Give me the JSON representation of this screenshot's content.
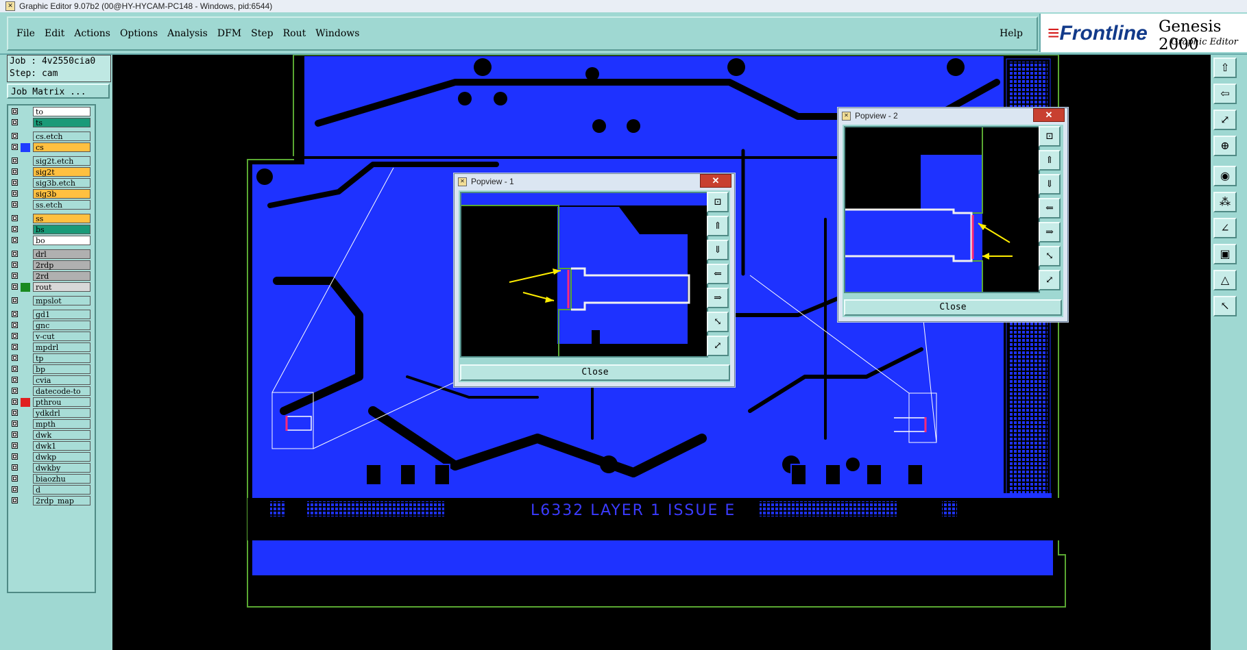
{
  "window": {
    "title": "Graphic Editor 9.07b2 (00@HY-HYCAM-PC148 - Windows, pid:6544)"
  },
  "menu": {
    "items": [
      "File",
      "Edit",
      "Actions",
      "Options",
      "Analysis",
      "DFM",
      "Step",
      "Rout",
      "Windows"
    ],
    "help": "Help"
  },
  "brand": {
    "logo_f": "F",
    "logo_rest": "Frontline",
    "product": "Genesis 2000",
    "subtitle": "Graphic Editor"
  },
  "job": {
    "job_line": "Job : 4v2550cia0",
    "step_line": "Step: cam",
    "matrix_label": "Job Matrix ..."
  },
  "layers": [
    {
      "name": "to",
      "color": "#ffffff",
      "swatch": ""
    },
    {
      "name": "ts",
      "color": "#1a9a78",
      "swatch": ""
    },
    {
      "name": "cs.etch",
      "color": "#a8ddd7",
      "swatch": ""
    },
    {
      "name": "cs",
      "color": "#ffc040",
      "swatch": "#1f3cff"
    },
    {
      "name": "sig2t.etch",
      "color": "#a8ddd7",
      "swatch": ""
    },
    {
      "name": "sig2t",
      "color": "#ffc040",
      "swatch": ""
    },
    {
      "name": "sig3b.etch",
      "color": "#a8ddd7",
      "swatch": ""
    },
    {
      "name": "sig3b",
      "color": "#ffc040",
      "swatch": ""
    },
    {
      "name": "ss.etch",
      "color": "#a8ddd7",
      "swatch": ""
    },
    {
      "name": "ss",
      "color": "#ffc040",
      "swatch": ""
    },
    {
      "name": "bs",
      "color": "#1a9a78",
      "swatch": ""
    },
    {
      "name": "bo",
      "color": "#ffffff",
      "swatch": ""
    },
    {
      "name": "drl",
      "color": "#b0b0b0",
      "swatch": ""
    },
    {
      "name": "2rdp",
      "color": "#b0b0b0",
      "swatch": ""
    },
    {
      "name": "2rd",
      "color": "#b0b0b0",
      "swatch": ""
    },
    {
      "name": "rout",
      "color": "#d8d8d8",
      "swatch": "#1a8a20"
    },
    {
      "name": "mpslot",
      "color": "#a8ddd7",
      "swatch": ""
    },
    {
      "name": "gd1",
      "color": "#a8ddd7",
      "swatch": ""
    },
    {
      "name": "gnc",
      "color": "#a8ddd7",
      "swatch": ""
    },
    {
      "name": "v-cut",
      "color": "#a8ddd7",
      "swatch": ""
    },
    {
      "name": "mpdrl",
      "color": "#a8ddd7",
      "swatch": ""
    },
    {
      "name": "tp",
      "color": "#a8ddd7",
      "swatch": ""
    },
    {
      "name": "bp",
      "color": "#a8ddd7",
      "swatch": ""
    },
    {
      "name": "cvia",
      "color": "#a8ddd7",
      "swatch": ""
    },
    {
      "name": "datecode-to",
      "color": "#a8ddd7",
      "swatch": ""
    },
    {
      "name": "pthrou",
      "color": "#a8ddd7",
      "swatch": "#e02020"
    },
    {
      "name": "ydkdrl",
      "color": "#a8ddd7",
      "swatch": ""
    },
    {
      "name": "mpth",
      "color": "#a8ddd7",
      "swatch": ""
    },
    {
      "name": "dwk",
      "color": "#a8ddd7",
      "swatch": ""
    },
    {
      "name": "dwk1",
      "color": "#a8ddd7",
      "swatch": ""
    },
    {
      "name": "dwkp",
      "color": "#a8ddd7",
      "swatch": ""
    },
    {
      "name": "dwkby",
      "color": "#a8ddd7",
      "swatch": ""
    },
    {
      "name": "biaozhu",
      "color": "#a8ddd7",
      "swatch": ""
    },
    {
      "name": "d",
      "color": "#a8ddd7",
      "swatch": ""
    },
    {
      "name": "2rdp_map",
      "color": "#a8ddd7",
      "swatch": ""
    }
  ],
  "board": {
    "label": "L6332 LAYER 1 ISSUE E"
  },
  "popup1": {
    "title": "Popview - 1",
    "close": "Close"
  },
  "popup2": {
    "title": "Popview - 2",
    "close": "Close"
  },
  "colors": {
    "copper": "#1e32ff",
    "outline": "#5aa832",
    "accent": "#ff2a7a",
    "arrow": "#ffee00",
    "panel": "#9fd8d2"
  }
}
